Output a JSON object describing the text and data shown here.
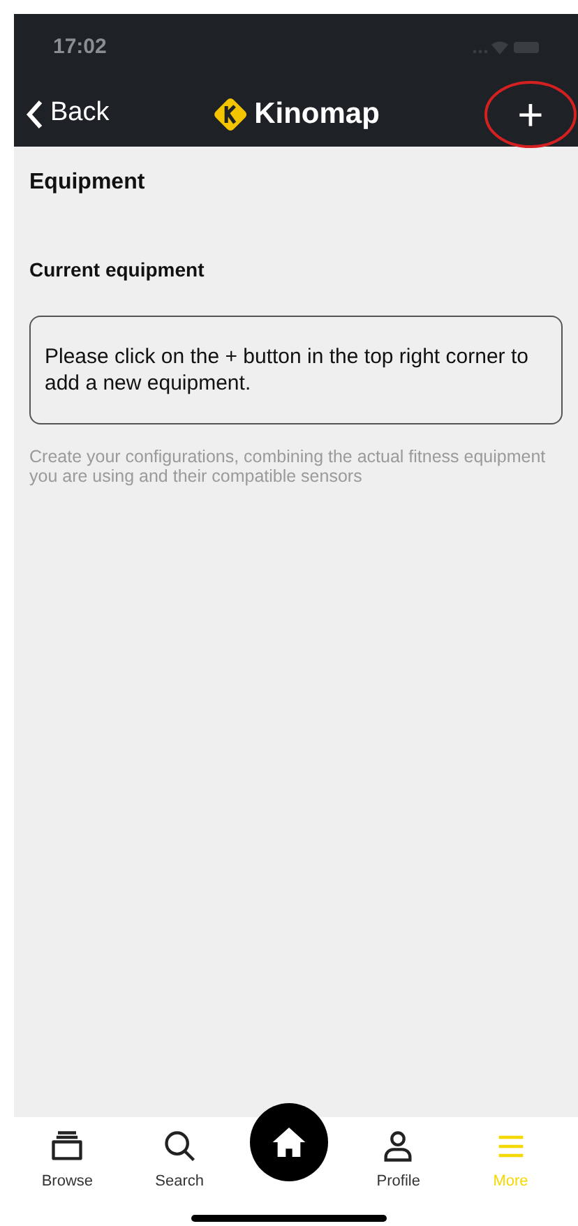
{
  "status_bar": {
    "time": "17:02"
  },
  "nav_bar": {
    "back_label": "Back",
    "logo_text": "Kinomap",
    "add_label": "+",
    "add_highlighted": true
  },
  "page": {
    "title": "Equipment",
    "section_title": "Current equipment",
    "empty_message": "Please click on the + button in the top right corner to add a new equipment.",
    "hint": "Create your configurations, combining the actual fitness equipment you are using and their compatible sensors"
  },
  "tab_bar": [
    {
      "kind": "browse",
      "label": "Browse",
      "selected": false
    },
    {
      "kind": "search",
      "label": "Search",
      "selected": false
    },
    {
      "kind": "home",
      "selected": false
    },
    {
      "kind": "profile",
      "label": "Profile",
      "selected": false
    },
    {
      "kind": "more",
      "label": "More",
      "selected": true
    }
  ]
}
